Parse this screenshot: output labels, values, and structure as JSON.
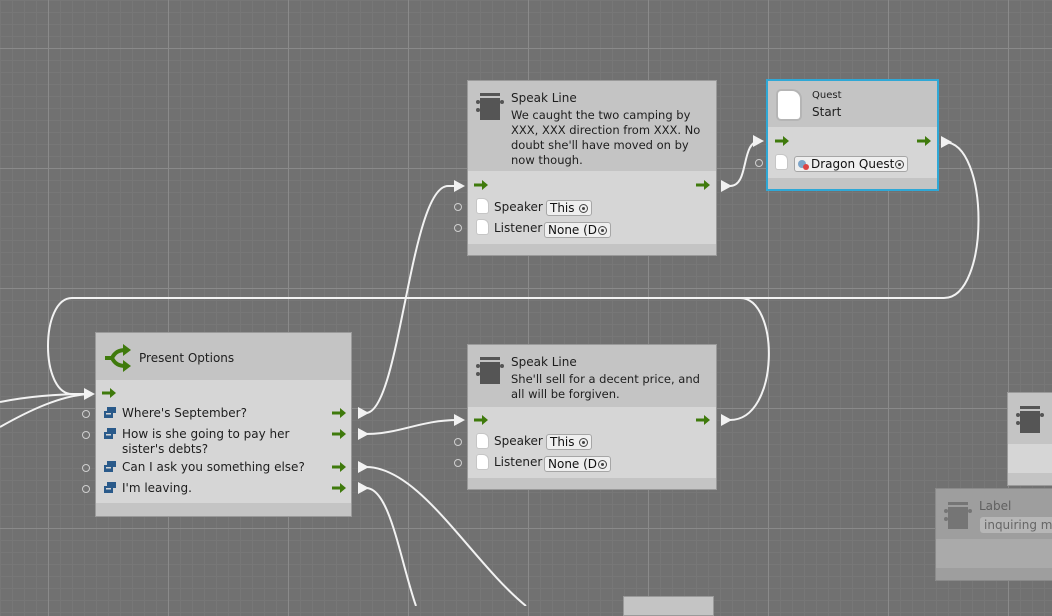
{
  "canvas": {
    "grid_color": "#717171",
    "connection_color": "#f2f2f2",
    "port_arrow_color": "#3f7a0c",
    "selection_color": "#2fa8d6"
  },
  "nodes": {
    "speak_line_1": {
      "title": "Speak Line",
      "text": "We caught the two camping by XXX, XXX direction from XXX. No doubt she'll have moved on by now though.",
      "speaker_label": "Speaker",
      "speaker_value": "This",
      "listener_label": "Listener",
      "listener_value": "None (D"
    },
    "quest_start": {
      "subtitle": "Quest",
      "title": "Start",
      "quest_value": "Dragon Quest",
      "selected": true
    },
    "present_options": {
      "title": "Present Options",
      "options": [
        {
          "label": "Where's September?"
        },
        {
          "label": "How is she going to pay her sister's debts?"
        },
        {
          "label": "Can I ask you something else?"
        },
        {
          "label": "I'm leaving."
        }
      ]
    },
    "speak_line_2": {
      "title": "Speak Line",
      "text": "She'll sell for a decent price, and all will be forgiven.",
      "speaker_label": "Speaker",
      "speaker_value": "This",
      "listener_label": "Listener",
      "listener_value": "None (D"
    },
    "label_node": {
      "title": "Label",
      "value": "inquiring mor"
    }
  }
}
